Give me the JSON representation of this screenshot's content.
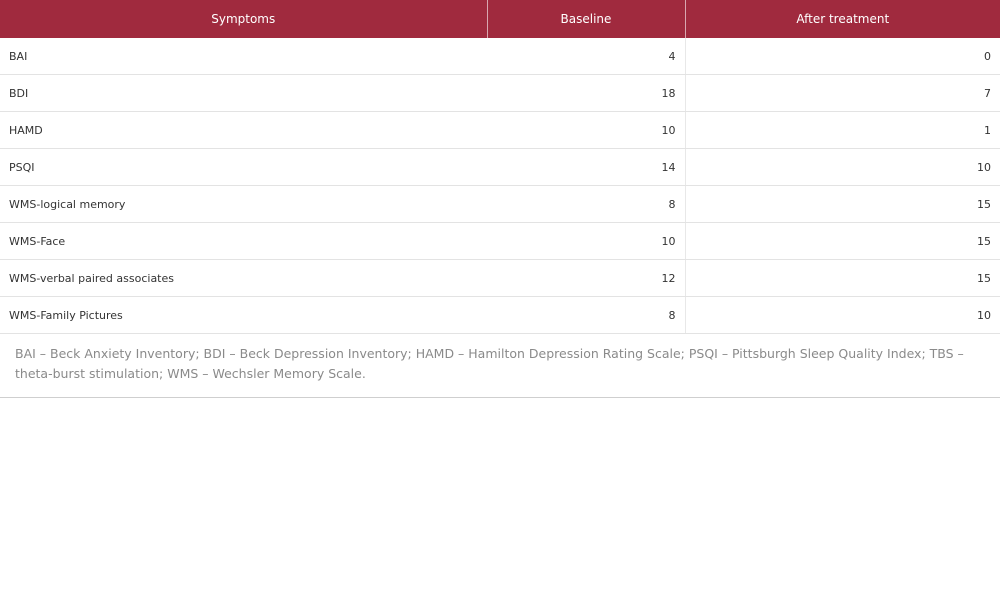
{
  "table": {
    "headers": [
      "Symptoms",
      "Baseline",
      "After treatment"
    ],
    "rows": [
      [
        "BAI",
        "4",
        "0"
      ],
      [
        "BDI",
        "18",
        "7"
      ],
      [
        "HAMD",
        "10",
        "1"
      ],
      [
        "PSQI",
        "14",
        "10"
      ],
      [
        "WMS-logical memory",
        "8",
        "15"
      ],
      [
        "WMS-Face",
        "10",
        "15"
      ],
      [
        "WMS-verbal paired associates",
        "12",
        "15"
      ],
      [
        "WMS-Family Pictures",
        "8",
        "10"
      ]
    ],
    "header_color": "#a02a3e"
  },
  "footnote": "BAI – Beck Anxiety Inventory; BDI – Beck Depression Inventory; HAMD – Hamilton Depression Rating Scale; PSQI – Pittsburgh Sleep Quality Index; TBS – theta-burst stimulation; WMS – Wechsler Memory Scale."
}
